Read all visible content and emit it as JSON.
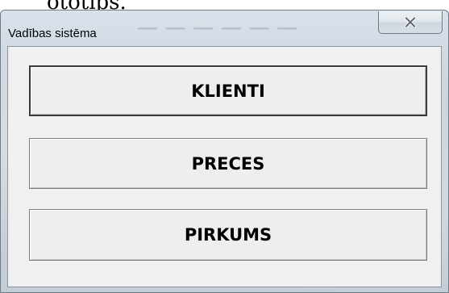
{
  "window": {
    "title": "Vadības sistēma"
  },
  "buttons": {
    "klienti": "KLIENTI",
    "preces": "PRECES",
    "pirkums": "PIRKUMS"
  },
  "icons": {
    "close": "close-icon"
  }
}
